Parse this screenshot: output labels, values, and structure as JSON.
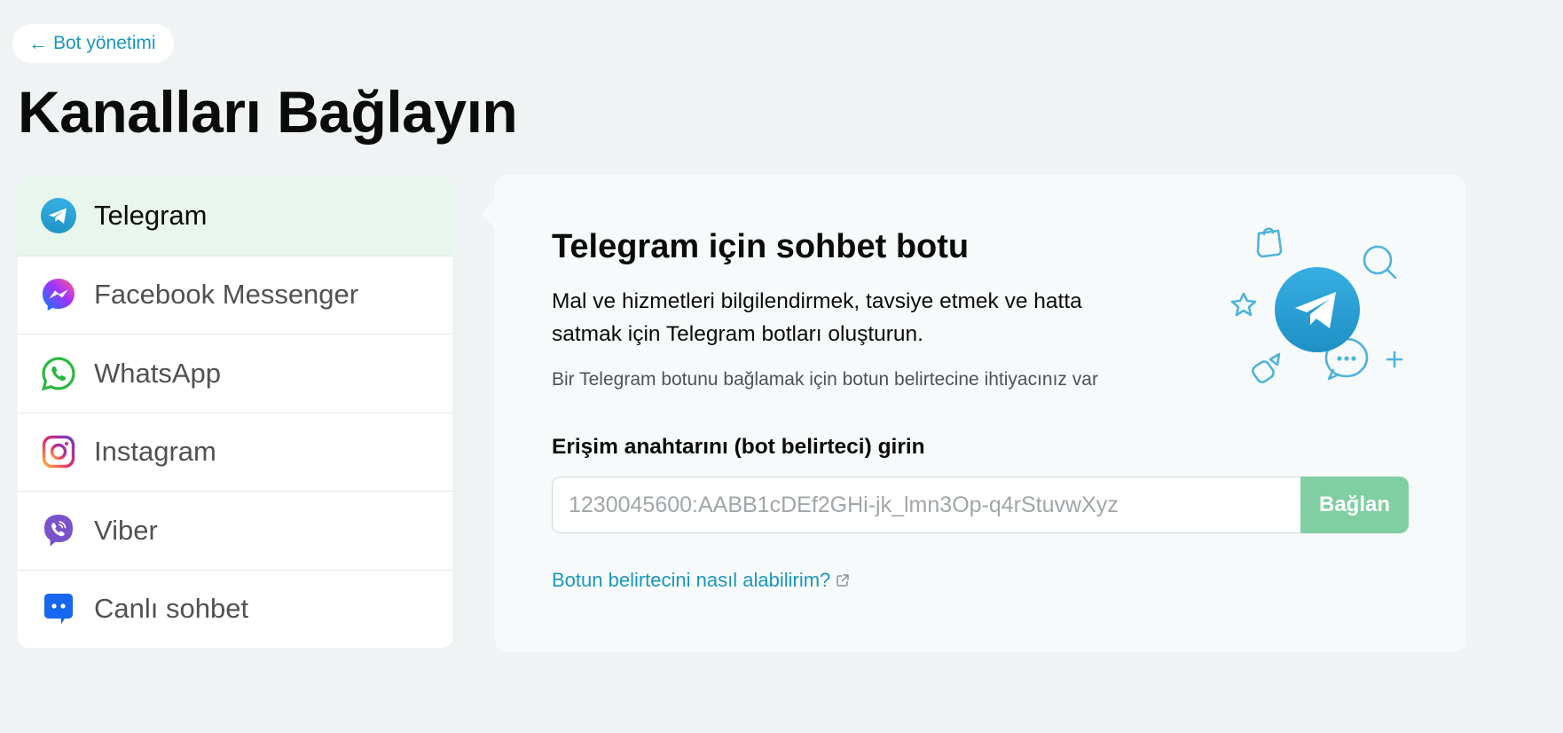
{
  "back_link": {
    "label": "Bot yönetimi"
  },
  "page_title": "Kanalları Bağlayın",
  "channels": [
    {
      "label": "Telegram",
      "icon": "telegram-icon",
      "active": true
    },
    {
      "label": "Facebook Messenger",
      "icon": "messenger-icon",
      "active": false
    },
    {
      "label": "WhatsApp",
      "icon": "whatsapp-icon",
      "active": false
    },
    {
      "label": "Instagram",
      "icon": "instagram-icon",
      "active": false
    },
    {
      "label": "Viber",
      "icon": "viber-icon",
      "active": false
    },
    {
      "label": "Canlı sohbet",
      "icon": "live-chat-icon",
      "active": false
    }
  ],
  "card": {
    "title": "Telegram için sohbet botu",
    "description": "Mal ve hizmetleri bilgilendirmek, tavsiye etmek ve hatta satmak için Telegram botları oluşturun.",
    "hint": "Bir Telegram botunu bağlamak için botun belirtecine ihtiyacınız var",
    "field_label": "Erişim anahtarını (bot belirteci) girin",
    "token_placeholder": "1230045600:AABB1cDEf2GHi-jk_lmn3Op-q4rStuvwXyz",
    "connect_label": "Bağlan",
    "help_link": "Botun belirtecini nasıl alabilirim?"
  },
  "colors": {
    "accent": "#1a97bd",
    "active_row": "#e9f6ee",
    "connect_button": "#7fcfa3",
    "telegram": "#2a9fd8"
  }
}
